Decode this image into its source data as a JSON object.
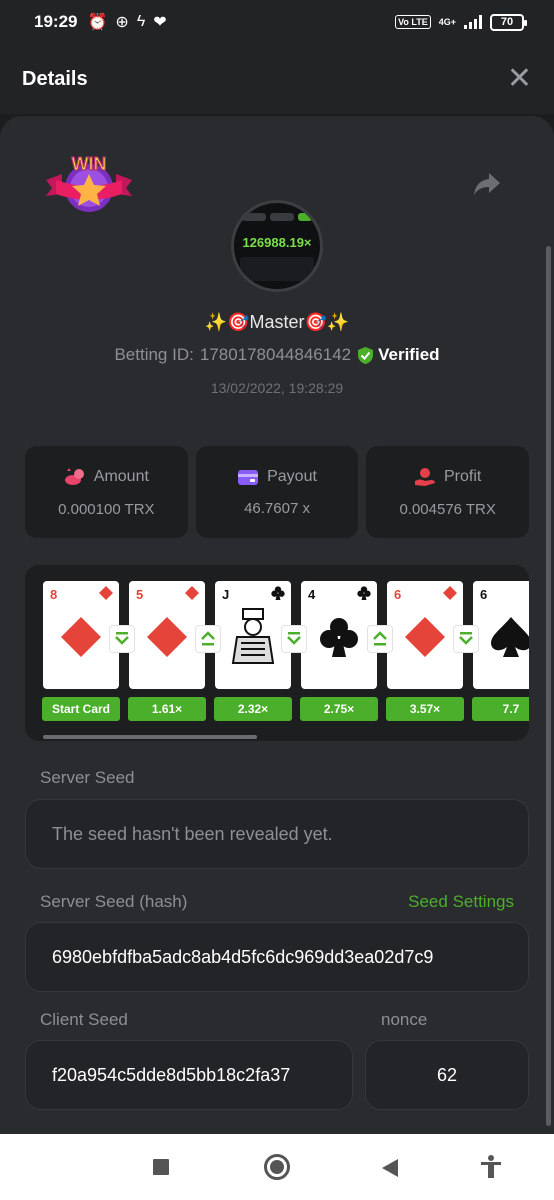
{
  "status_bar": {
    "time": "19:29",
    "network": "4G+",
    "battery": "70"
  },
  "header": {
    "title": "Details",
    "close_icon": "close-icon"
  },
  "bet": {
    "badge_text": "WIN",
    "avatar_multiplier": "126988.19×",
    "username": "✨🎯Master🎯✨",
    "betting_id_label": "Betting ID:",
    "betting_id": "1780178044846142",
    "verified_label": "Verified",
    "timestamp": "13/02/2022, 19:28:29"
  },
  "stats": [
    {
      "label": "Amount",
      "value": "0.000100 TRX",
      "icon": "coins-icon",
      "color": "#e8436a"
    },
    {
      "label": "Payout",
      "value": "46.7607 x",
      "icon": "wallet-icon",
      "color": "#8a5cf6"
    },
    {
      "label": "Profit",
      "value": "0.004576 TRX",
      "icon": "money-hand-icon",
      "color": "#e5404a"
    }
  ],
  "cards": [
    {
      "rank": "8",
      "suit": "diamond",
      "color": "#e5443b",
      "multiplier": "Start Card",
      "guess": "down"
    },
    {
      "rank": "5",
      "suit": "diamond",
      "color": "#e5443b",
      "multiplier": "1.61×",
      "guess": "up"
    },
    {
      "rank": "J",
      "suit": "club",
      "color": "#111111",
      "multiplier": "2.32×",
      "guess": "down"
    },
    {
      "rank": "4",
      "suit": "club",
      "color": "#111111",
      "multiplier": "2.75×",
      "guess": "up"
    },
    {
      "rank": "6",
      "suit": "diamond",
      "color": "#e5443b",
      "multiplier": "3.57×",
      "guess": "down"
    },
    {
      "rank": "6",
      "suit": "spade",
      "color": "#111111",
      "multiplier": "7.7",
      "guess": ""
    }
  ],
  "server_seed": {
    "label": "Server Seed",
    "value": "The seed hasn't been revealed yet."
  },
  "server_seed_hash": {
    "label": "Server Seed (hash)",
    "settings_link": "Seed Settings",
    "value": "6980ebfdfba5adc8ab4d5fc6dc969dd3ea02d7c9"
  },
  "client_seed": {
    "label": "Client Seed",
    "value": "f20a954c5dde8d5bb18c2fa37"
  },
  "nonce": {
    "label": "nonce",
    "value": "62"
  },
  "colors": {
    "accent_green": "#4caf2b",
    "background": "#1c1d1f",
    "panel": "#2a2b2e"
  }
}
